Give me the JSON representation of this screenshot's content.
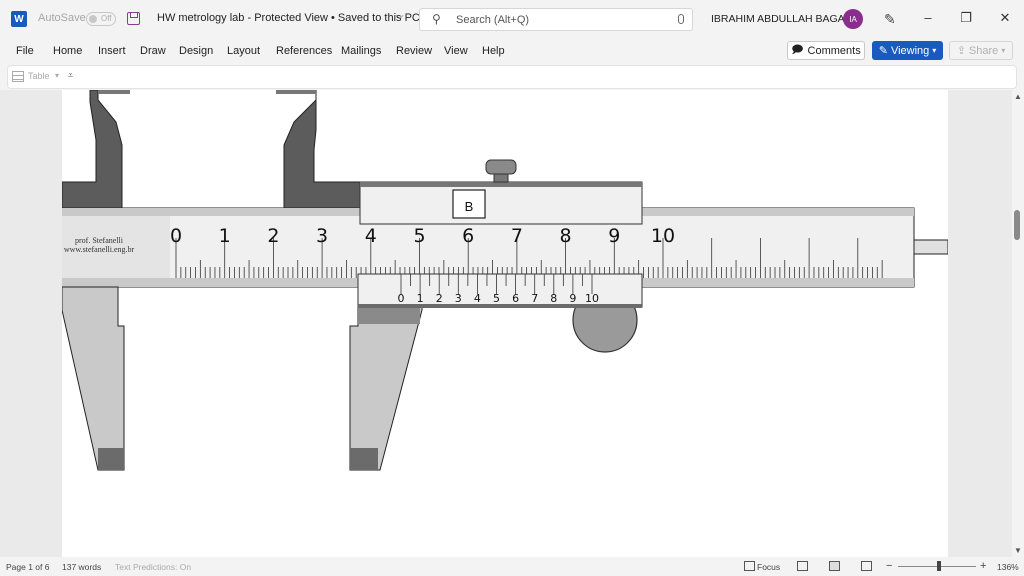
{
  "titlebar": {
    "app_logo": "W",
    "autosave_label": "AutoSave",
    "autosave_state": "Off",
    "doc_title": "HW metrology lab  -  Protected View • Saved to this PC",
    "search_placeholder": "Search (Alt+Q)",
    "user_name": "IBRAHIM ABDULLAH BAGAZI",
    "user_initials": "IA"
  },
  "ribbon": {
    "tabs": [
      "File",
      "Home",
      "Insert",
      "Draw",
      "Design",
      "Layout",
      "References",
      "Mailings",
      "Review",
      "View",
      "Help"
    ],
    "comments_label": "Comments",
    "viewing_label": "Viewing",
    "share_label": "Share"
  },
  "quick_toolbar": {
    "table_label": "Table"
  },
  "document": {
    "caliper": {
      "brand_line1": "prof. Stefanelli",
      "brand_line2": "www.stefanelli.eng.br",
      "main_scale_labels": [
        "0",
        "1",
        "2",
        "3",
        "4",
        "5",
        "6",
        "7",
        "8",
        "9",
        "10"
      ],
      "vernier_scale_labels": [
        "0",
        "1",
        "2",
        "3",
        "4",
        "5",
        "6",
        "7",
        "8",
        "9",
        "10"
      ],
      "box_label": "B"
    }
  },
  "statusbar": {
    "page_info": "Page 1 of 6",
    "word_count": "137 words",
    "text_predictions": "Text Predictions: On",
    "focus_label": "Focus",
    "zoom_level": "136%"
  },
  "colors": {
    "accent": "#185abd",
    "avatar": "#8b2c8f"
  }
}
